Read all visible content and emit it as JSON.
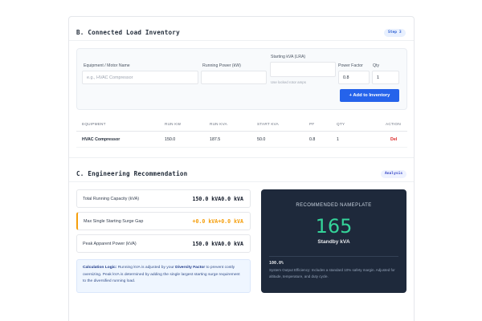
{
  "section_b": {
    "title": "B. Connected Load Inventory",
    "step_badge": "Step 3",
    "form": {
      "equipment_label": "Equipment / Motor Name",
      "equipment_placeholder": "e.g., HVAC Compressor",
      "running_power_label": "Running Power (kW)",
      "running_power_value": "",
      "starting_kva_label": "Starting kVA (LRA)",
      "starting_kva_value": "",
      "starting_kva_hint": "Use locked rotor amps",
      "power_factor_label": "Power Factor",
      "power_factor_value": "0.8",
      "qty_label": "Qty",
      "qty_value": "1",
      "add_button": "+ Add to Inventory"
    },
    "table": {
      "headers": [
        "EQUIPMENT",
        "RUN KW",
        "RUN KVA",
        "START KVA",
        "PF",
        "QTY",
        "ACTION"
      ],
      "rows": [
        {
          "equipment": "HVAC Compressor",
          "run_kw": "150.0",
          "run_kva": "187.5",
          "start_kva": "50.0",
          "pf": "0.8",
          "qty": "1",
          "action": "Del"
        }
      ]
    }
  },
  "section_c": {
    "title": "C. Engineering Recommendation",
    "badge": "Analysis",
    "metrics": [
      {
        "label": "Total Running Capacity (kVA)",
        "value": "150.0 kVA0.0 kVA"
      },
      {
        "label": "Max Single Starting Surge Gap",
        "value": "+0.0 kVA+0.0 kVA"
      },
      {
        "label": "Peak Apparent Power (kVA)",
        "value": "150.0 kVA0.0 kVA"
      }
    ],
    "logic": {
      "lead": "Calculation Logic:",
      "t1": " Running kVA is adjusted by your ",
      "em": "Diversity Factor",
      "t2": " to prevent costly oversizing. Peak kVA is determined by adding the single largest starting surge requirement to the diversified running load."
    },
    "recommendation": {
      "title": "RECOMMENDED NAMEPLATE",
      "value": "165",
      "unit": "Standby kVA",
      "efficiency": "100.0%",
      "note": "System Output Efficiency: Includes a standard 10% safety margin. Adjusted for altitude, temperature, and duty cycle."
    }
  },
  "colors": {
    "accent": "#2563eb",
    "warning": "#f59e0b",
    "danger": "#dc2626",
    "rec_background": "#1e293b",
    "rec_value": "#34d399"
  }
}
